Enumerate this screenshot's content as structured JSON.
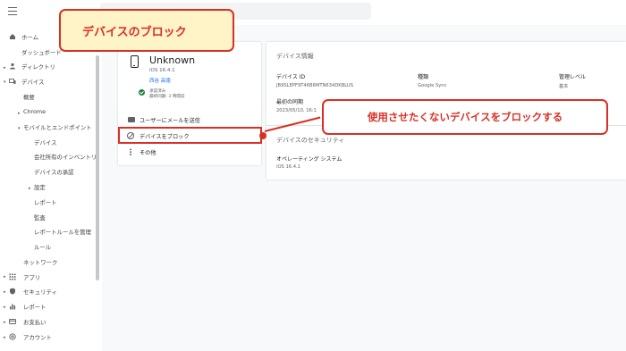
{
  "sidebar": {
    "items": [
      {
        "label": "ホーム"
      },
      {
        "label": "ダッシュボード"
      },
      {
        "label": "ディレクトリ"
      },
      {
        "label": "デバイス"
      },
      {
        "label": "概要"
      },
      {
        "label": "Chrome"
      },
      {
        "label": "モバイルとエンドポイント"
      },
      {
        "label": "デバイス"
      },
      {
        "label": "会社所有のインベントリ"
      },
      {
        "label": "デバイスの承認"
      },
      {
        "label": "設定"
      },
      {
        "label": "レポート"
      },
      {
        "label": "監査"
      },
      {
        "label": "レポートルールを管理"
      },
      {
        "label": "ルール"
      },
      {
        "label": "ネットワーク"
      },
      {
        "label": "アプリ"
      },
      {
        "label": "セキュリティ"
      },
      {
        "label": "レポート"
      },
      {
        "label": "お支払い"
      },
      {
        "label": "アカウント"
      }
    ]
  },
  "device": {
    "name": "Unknown",
    "os": "iOS 16.4.1",
    "owner": "西谷 高徳",
    "status_line1": "承認済み",
    "status_line2": "最終同期: 3 時間前"
  },
  "actions": {
    "email": "ユーザーにメールを送信",
    "block": "デバイスをブロック",
    "more": "その他"
  },
  "info": {
    "title": "デバイス情報",
    "device_id_label": "デバイス ID",
    "device_id_value": "JB9SLEPF9T46B6MTN634DKBLUS",
    "type_label": "種類",
    "type_value": "Google Sync",
    "mgmt_label": "管理レベル",
    "mgmt_value": "基本",
    "first_sync_label": "最初の同期",
    "first_sync_value": "2023/05/10, 16:1"
  },
  "security": {
    "title": "デバイスのセキュリティ",
    "os_label": "オペレーティング システム",
    "os_value": "iOS 16.4.1"
  },
  "annotations": {
    "top_callout": "デバイスのブロック",
    "right_callout": "使用させたくないデバイスをブロックする"
  },
  "colors": {
    "accent_red": "#d93025",
    "callout_fill": "#fff3c8",
    "link_blue": "#1a73e8",
    "status_green": "#188038"
  }
}
